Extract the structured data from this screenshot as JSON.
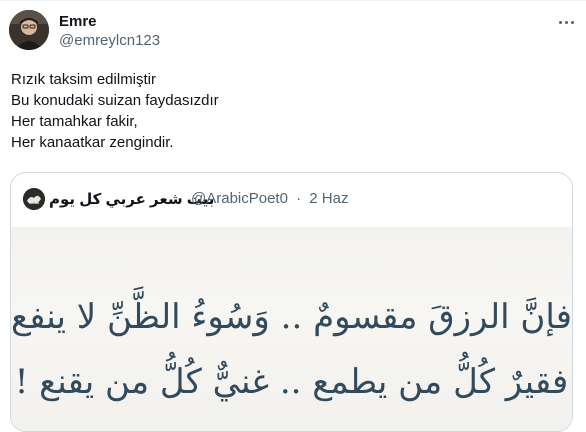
{
  "author": {
    "name": "Emre",
    "handle": "@emreylcn123"
  },
  "tweet": {
    "lines": [
      "Rızık taksim edilmiştir",
      "Bu konudaki suizan faydasızdır",
      "Her tamahkar fakir,",
      "Her kanaatkar zengindir."
    ]
  },
  "quote": {
    "name": "بيت شعر عربي كل يوم",
    "handle": "@ArabicPoet0",
    "separator": "·",
    "date": "2 Haz",
    "image_lines": [
      "فإنَّ الرزقَ مقسومٌ .. وَسُوءُ الظَّنِّ لا ينفع،",
      "فقيرٌ كُلُّ من يطمع .. غنيٌّ كُلُّ من يقنع !"
    ]
  },
  "icons": {
    "more": "more-horizontal-icon"
  },
  "colors": {
    "text": "#0f1419",
    "secondary": "#536471",
    "border": "#cfd9de",
    "arabic_ink": "#314a5c"
  }
}
